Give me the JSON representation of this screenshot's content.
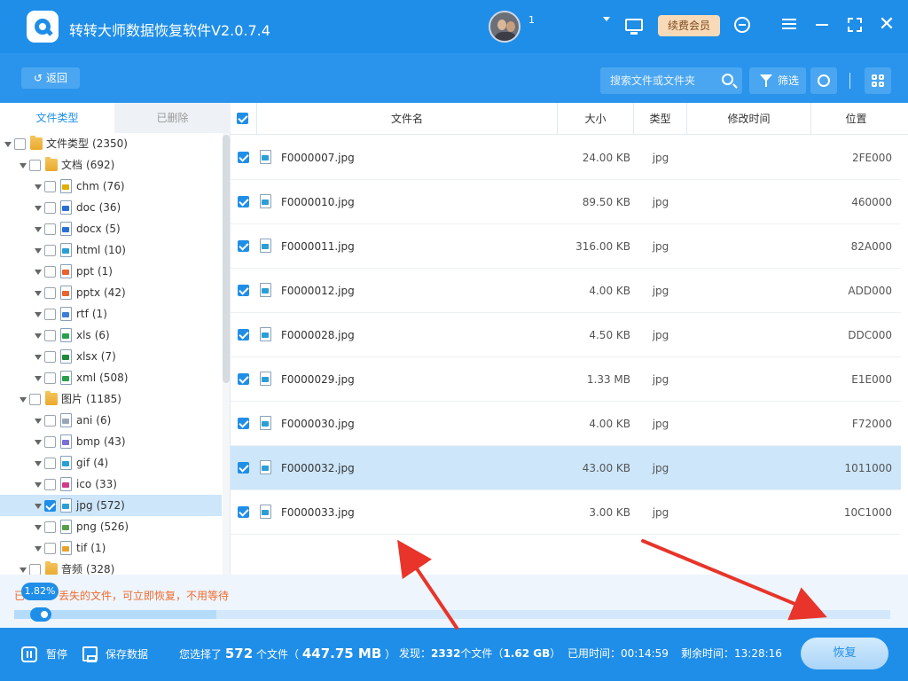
{
  "app": {
    "title": "转转大师数据恢复软件V2.0.7.4",
    "username": "1",
    "vip_label": "续费会员",
    "icons": [
      "logo-icon",
      "avatar",
      "monitor-icon",
      "support-icon",
      "menu-icon",
      "minimize-icon",
      "maximize-icon",
      "close-icon"
    ]
  },
  "toolbar": {
    "back_label": "返回",
    "search_placeholder": "搜索文件或文件夹",
    "filter_label": "筛选"
  },
  "left_tabs": [
    "文件类型",
    "已删除"
  ],
  "tree": [
    {
      "level": 0,
      "icon": "folder",
      "name": "文件类型",
      "count": "(2350)",
      "checked": false,
      "selected": false
    },
    {
      "level": 1,
      "icon": "folder",
      "name": "文档",
      "count": "(692)",
      "checked": false,
      "selected": false
    },
    {
      "level": 2,
      "icon": "chm",
      "name": "chm",
      "count": "(76)",
      "checked": false,
      "selected": false
    },
    {
      "level": 2,
      "icon": "doc",
      "name": "doc",
      "count": "(36)",
      "checked": false,
      "selected": false
    },
    {
      "level": 2,
      "icon": "docx",
      "name": "docx",
      "count": "(5)",
      "checked": false,
      "selected": false
    },
    {
      "level": 2,
      "icon": "html",
      "name": "html",
      "count": "(10)",
      "checked": false,
      "selected": false
    },
    {
      "level": 2,
      "icon": "ppt",
      "name": "ppt",
      "count": "(1)",
      "checked": false,
      "selected": false
    },
    {
      "level": 2,
      "icon": "pptx",
      "name": "pptx",
      "count": "(42)",
      "checked": false,
      "selected": false
    },
    {
      "level": 2,
      "icon": "rtf",
      "name": "rtf",
      "count": "(1)",
      "checked": false,
      "selected": false
    },
    {
      "level": 2,
      "icon": "xls",
      "name": "xls",
      "count": "(6)",
      "checked": false,
      "selected": false
    },
    {
      "level": 2,
      "icon": "xlsx",
      "name": "xlsx",
      "count": "(7)",
      "checked": false,
      "selected": false
    },
    {
      "level": 2,
      "icon": "xml",
      "name": "xml",
      "count": "(508)",
      "checked": false,
      "selected": false
    },
    {
      "level": 1,
      "icon": "folder",
      "name": "图片",
      "count": "(1185)",
      "checked": false,
      "selected": false
    },
    {
      "level": 2,
      "icon": "ani",
      "name": "ani",
      "count": "(6)",
      "checked": false,
      "selected": false
    },
    {
      "level": 2,
      "icon": "bmp",
      "name": "bmp",
      "count": "(43)",
      "checked": false,
      "selected": false
    },
    {
      "level": 2,
      "icon": "gif",
      "name": "gif",
      "count": "(4)",
      "checked": false,
      "selected": false
    },
    {
      "level": 2,
      "icon": "ico",
      "name": "ico",
      "count": "(33)",
      "checked": false,
      "selected": false
    },
    {
      "level": 2,
      "icon": "jpg",
      "name": "jpg",
      "count": "(572)",
      "checked": true,
      "selected": true
    },
    {
      "level": 2,
      "icon": "png",
      "name": "png",
      "count": "(526)",
      "checked": false,
      "selected": false
    },
    {
      "level": 2,
      "icon": "tif",
      "name": "tif",
      "count": "(1)",
      "checked": false,
      "selected": false
    },
    {
      "level": 1,
      "icon": "folder",
      "name": "音频",
      "count": "(328)",
      "checked": false,
      "selected": false
    }
  ],
  "table": {
    "columns": [
      "文件名",
      "大小",
      "类型",
      "修改时间",
      "位置"
    ],
    "rows": [
      {
        "name": "F0000007.jpg",
        "size": "24.00 KB",
        "type": "jpg",
        "mtime": "",
        "location": "2FE000",
        "checked": true,
        "selected": false
      },
      {
        "name": "F0000010.jpg",
        "size": "89.50 KB",
        "type": "jpg",
        "mtime": "",
        "location": "460000",
        "checked": true,
        "selected": false
      },
      {
        "name": "F0000011.jpg",
        "size": "316.00 KB",
        "type": "jpg",
        "mtime": "",
        "location": "82A000",
        "checked": true,
        "selected": false
      },
      {
        "name": "F0000012.jpg",
        "size": "4.00 KB",
        "type": "jpg",
        "mtime": "",
        "location": "ADD000",
        "checked": true,
        "selected": false
      },
      {
        "name": "F0000028.jpg",
        "size": "4.50 KB",
        "type": "jpg",
        "mtime": "",
        "location": "DDC000",
        "checked": true,
        "selected": false
      },
      {
        "name": "F0000029.jpg",
        "size": "1.33 MB",
        "type": "jpg",
        "mtime": "",
        "location": "E1E000",
        "checked": true,
        "selected": false
      },
      {
        "name": "F0000030.jpg",
        "size": "4.00 KB",
        "type": "jpg",
        "mtime": "",
        "location": "F72000",
        "checked": true,
        "selected": false
      },
      {
        "name": "F0000032.jpg",
        "size": "43.00 KB",
        "type": "jpg",
        "mtime": "",
        "location": "1011000",
        "checked": true,
        "selected": true
      },
      {
        "name": "F0000033.jpg",
        "size": "3.00 KB",
        "type": "jpg",
        "mtime": "",
        "location": "10C1000",
        "checked": true,
        "selected": false
      }
    ]
  },
  "progress": {
    "percent_label": "1.82%",
    "fraction": 0.0182,
    "text_prefix": "已",
    "text": "丢失的文件，可立即恢复，不用等待"
  },
  "bottom": {
    "pause_label": "暂停",
    "save_label": "保存数据",
    "selected_prefix": "您选择了",
    "selected_count": "572",
    "selected_unit": "个文件（",
    "selected_size": "447.75 MB",
    "selected_suffix": "）",
    "found_prefix": "发现：",
    "found_count": "2332",
    "found_unit": "个文件（",
    "found_size": "1.62 GB",
    "found_suffix": "）",
    "elapsed_label": "已用时间：",
    "elapsed": "00:14:59",
    "remaining_label": "剩余时间：",
    "remaining": "13:28:16",
    "recover_label": "恢复"
  },
  "colors": {
    "brand": "#1f8ee8",
    "toolbar": "#2a94ec",
    "selected_row": "#cde6fa",
    "warning_text": "#f06b2f",
    "annotation_arrow": "#e8342a"
  }
}
